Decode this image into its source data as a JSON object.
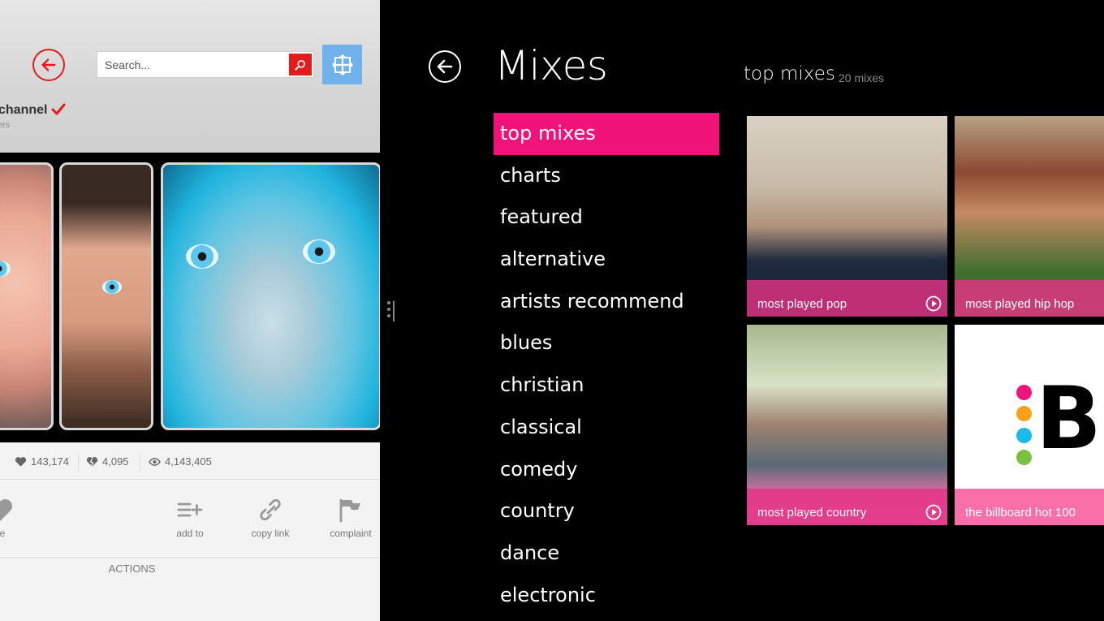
{
  "left_app": {
    "search": {
      "placeholder": "Search..."
    },
    "channel": {
      "name": "channel",
      "subscribers_fragment": "ers"
    },
    "stats": {
      "likes": "143,174",
      "dislikes": "4,095",
      "views": "4,143,405"
    },
    "actions": [
      {
        "label": "ke",
        "icon": "heart-icon"
      },
      {
        "label": "add to",
        "icon": "add-to-list-icon"
      },
      {
        "label": "copy link",
        "icon": "link-icon"
      },
      {
        "label": "complaint",
        "icon": "flag-icon"
      }
    ],
    "actions_section_label": "ACTIONS",
    "colors": {
      "accent": "#e21b1b",
      "snap_button": "#6fb2ec"
    }
  },
  "mixes_app": {
    "title": "Mixes",
    "categories": [
      "top mixes",
      "charts",
      "featured",
      "alternative",
      "artists recommend",
      "blues",
      "christian",
      "classical",
      "comedy",
      "country",
      "dance",
      "electronic"
    ],
    "selected_category": "top mixes",
    "section": {
      "title": "top mixes",
      "count": "20 mixes"
    },
    "tiles": [
      {
        "label": "most played pop",
        "play_icon": true
      },
      {
        "label": "most played hip hop",
        "play_icon": false
      },
      {
        "label": "most played country",
        "play_icon": true
      },
      {
        "label": "the billboard hot 100",
        "play_icon": false
      }
    ],
    "colors": {
      "accent": "#f0137a",
      "tile_caption": "#e23284",
      "billboard_caption": "#f96fa7"
    },
    "billboard_logo": {
      "letter": "B",
      "dot_colors": [
        "#f0137a",
        "#f7a11a",
        "#1bbbe9",
        "#7ac142"
      ]
    }
  }
}
